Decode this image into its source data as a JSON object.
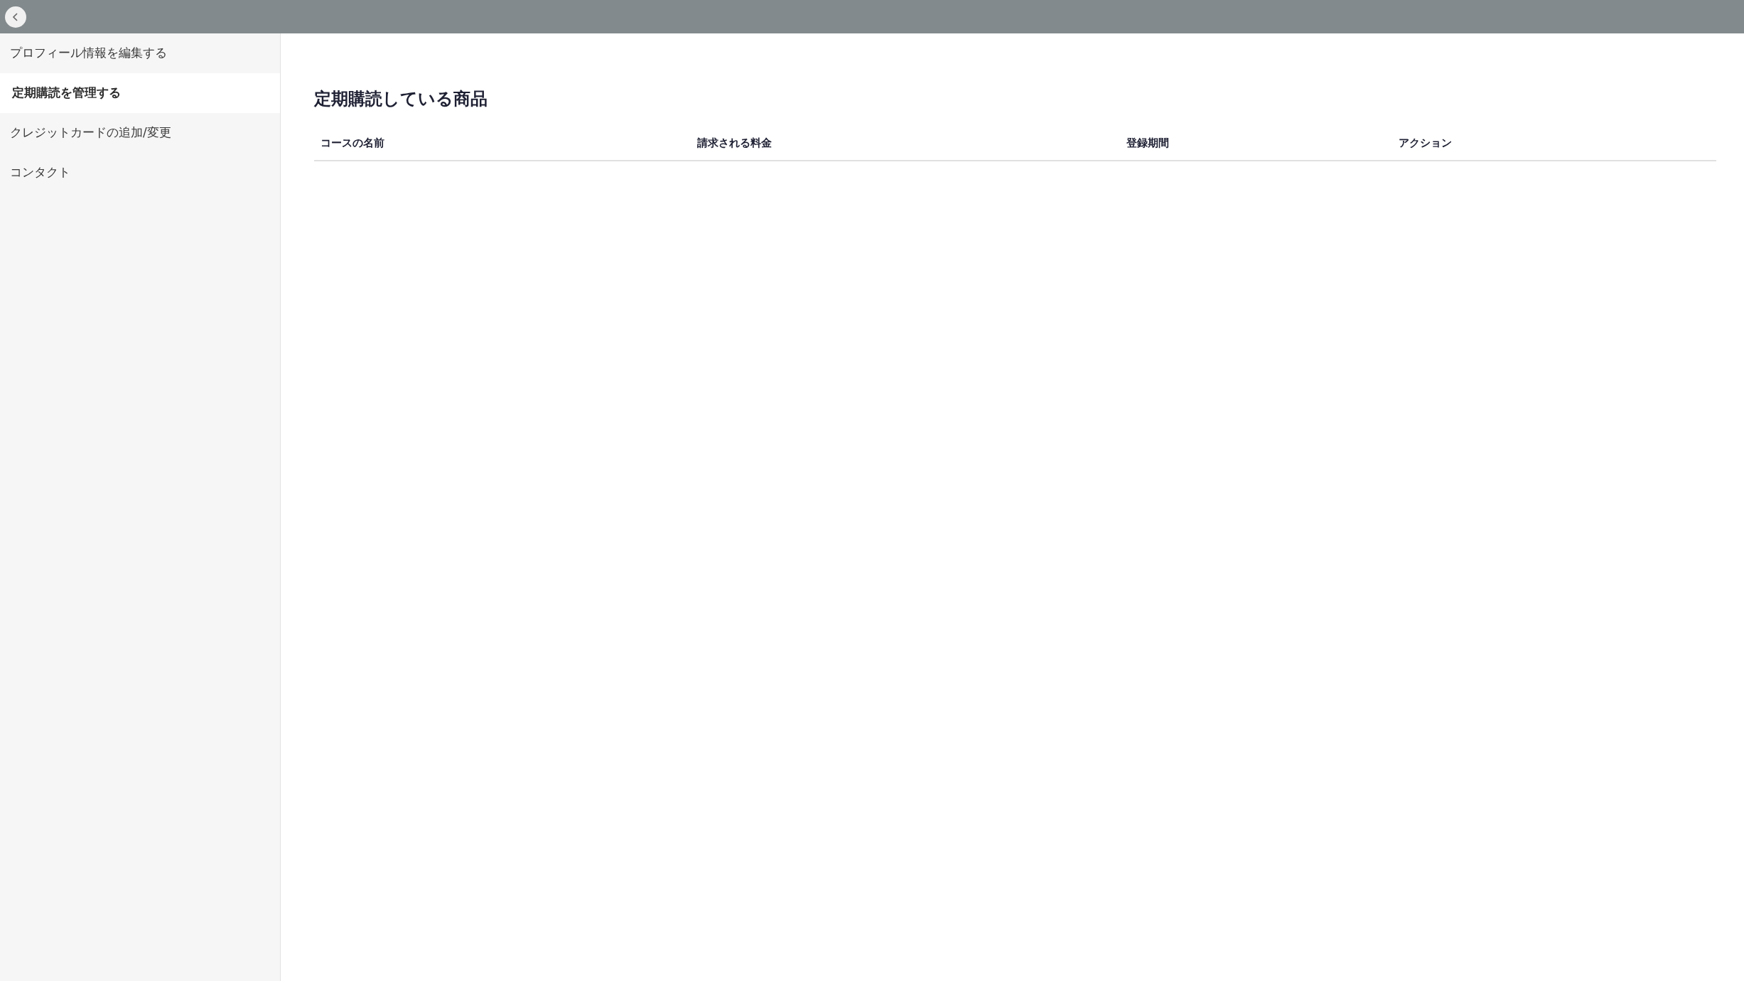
{
  "sidebar": {
    "items": [
      {
        "label": "プロフィール情報を編集する",
        "selected": false
      },
      {
        "label": "定期購読を管理する",
        "selected": true
      },
      {
        "label": "クレジットカードの追加/変更",
        "selected": false
      },
      {
        "label": "コンタクト",
        "selected": false
      }
    ]
  },
  "main": {
    "title": "定期購読している商品",
    "table": {
      "columns": [
        "コースの名前",
        "請求される料金",
        "登録期間",
        "アクション"
      ]
    }
  }
}
